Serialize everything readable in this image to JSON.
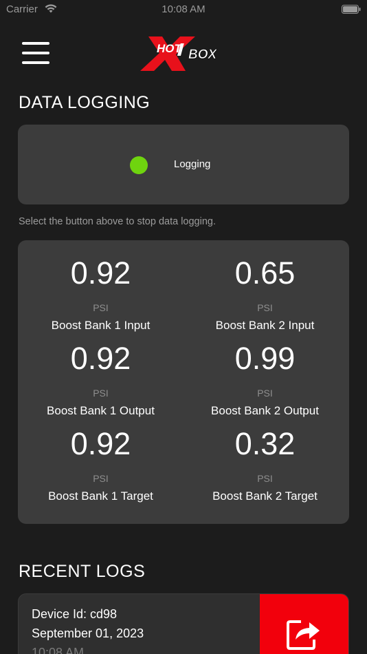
{
  "status_bar": {
    "carrier": "Carrier",
    "time": "10:08 AM"
  },
  "header": {
    "logo_text": "HOTBOX",
    "icons": [
      "menu-icon",
      "logo"
    ]
  },
  "data_logging": {
    "title": "DATA LOGGING",
    "status_label": "Logging",
    "status_color": "#6fd40f",
    "hint": "Select the button above to stop data logging."
  },
  "metrics": [
    {
      "value": "0.92",
      "unit": "PSI",
      "label": "Boost Bank 1 Input"
    },
    {
      "value": "0.65",
      "unit": "PSI",
      "label": "Boost Bank 2 Input"
    },
    {
      "value": "0.92",
      "unit": "PSI",
      "label": "Boost Bank 1 Output"
    },
    {
      "value": "0.99",
      "unit": "PSI",
      "label": "Boost Bank 2 Output"
    },
    {
      "value": "0.92",
      "unit": "PSI",
      "label": "Boost Bank 1 Target"
    },
    {
      "value": "0.32",
      "unit": "PSI",
      "label": "Boost Bank 2 Target"
    }
  ],
  "recent_logs": {
    "title": "RECENT LOGS",
    "items": [
      {
        "device": "Device Id: cd98",
        "date": "September 01, 2023",
        "time": "10:08 AM"
      }
    ],
    "share_icon": "share-icon",
    "share_color": "#f2000c"
  }
}
